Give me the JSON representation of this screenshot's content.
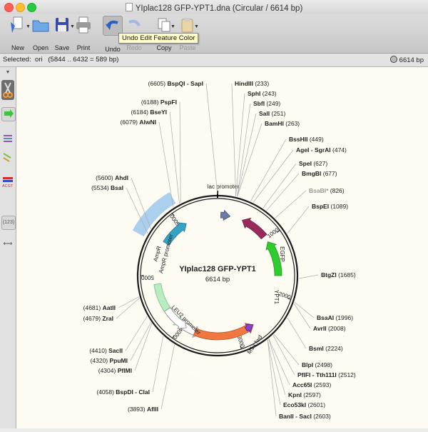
{
  "window": {
    "title": "YIplac128 GFP-YPT1.dna  (Circular / 6614 bp)"
  },
  "toolbar": {
    "new": "New",
    "open": "Open",
    "save": "Save",
    "print": "Print",
    "undo": "Undo",
    "redo": "Redo",
    "copy": "Copy",
    "paste": "Paste",
    "tooltip": "Undo Edit Feature Color"
  },
  "selection": {
    "label": "Selected:",
    "name": "ori",
    "range": "(5844 .. 6432  =  589 bp)",
    "total": "6614 bp"
  },
  "sidebar": {
    "count": "(123)"
  },
  "map": {
    "name": "YIplac128 GFP-YPT1",
    "length": "6614 bp",
    "colors": {
      "ori": "#4a7fc1",
      "lac": "#9aa0b5",
      "ypt1": "#9a2a5c",
      "egfp": "#2ecc2e",
      "ampr": "#b9ecc1",
      "leu2prom": "#ffffff",
      "leu2": "#f07840",
      "m13": "#8a40d0",
      "backbone": "#1a1a1a",
      "highlight": "#9cc8ec"
    },
    "features": [
      {
        "name": "ori",
        "label": "ori"
      },
      {
        "name": "lac-promoter",
        "label": "lac promoter"
      },
      {
        "name": "ypt1",
        "label": "YPT1"
      },
      {
        "name": "egfp",
        "label": "EGFP"
      },
      {
        "name": "ypt1-b",
        "label": "YPT1"
      },
      {
        "name": "ampr",
        "label": "AmpR"
      },
      {
        "name": "ampr-promoter",
        "label": "AmpR promoter"
      },
      {
        "name": "leu2-promoter",
        "label": "LEU2 promoter"
      },
      {
        "name": "leu2",
        "label": "LEU2"
      },
      {
        "name": "m13-fwd",
        "label": "M13 fwd"
      }
    ],
    "ticks": [
      "1000",
      "2000",
      "3000",
      "4000",
      "5000",
      "6000"
    ],
    "sites": [
      {
        "bold": "BspQI - SapI",
        "pos": "(6605)"
      },
      {
        "bold": "PspFI",
        "pos": "(6188)"
      },
      {
        "bold": "BseYI",
        "pos": "(6184)"
      },
      {
        "bold": "AlwNI",
        "pos": "(6079)"
      },
      {
        "bold": "AhdI",
        "pos": "(5600)"
      },
      {
        "bold": "BsaI",
        "pos": "(5534)"
      },
      {
        "bold": "AatII",
        "pos": "(4681)"
      },
      {
        "bold": "ZraI",
        "pos": "(4679)"
      },
      {
        "bold": "SacII",
        "pos": "(4410)"
      },
      {
        "bold": "PpuMI",
        "pos": "(4320)"
      },
      {
        "bold": "PflMI",
        "pos": "(4304)"
      },
      {
        "bold": "BspDI - ClaI",
        "pos": "(4058)"
      },
      {
        "bold": "AflII",
        "pos": "(3893)"
      },
      {
        "bold": "HindIII",
        "pos": "(233)"
      },
      {
        "bold": "SphI",
        "pos": "(243)"
      },
      {
        "bold": "SbfI",
        "pos": "(249)"
      },
      {
        "bold": "SalI",
        "pos": "(251)"
      },
      {
        "bold": "BamHI",
        "pos": "(263)"
      },
      {
        "bold": "BssHII",
        "pos": "(449)"
      },
      {
        "bold": "AgeI - SgrAI",
        "pos": "(474)"
      },
      {
        "bold": "SpeI",
        "pos": "(627)"
      },
      {
        "bold": "BmgBI",
        "pos": "(677)"
      },
      {
        "bold": "BsaBI*",
        "pos": "(826)"
      },
      {
        "bold": "BspEI",
        "pos": "(1089)"
      },
      {
        "bold": "BtgZI",
        "pos": "(1685)"
      },
      {
        "bold": "BsaAI",
        "pos": "(1996)"
      },
      {
        "bold": "AvrII",
        "pos": "(2008)"
      },
      {
        "bold": "BsmI",
        "pos": "(2224)"
      },
      {
        "bold": "BlpI",
        "pos": "(2498)"
      },
      {
        "bold": "PflFI - Tth111I",
        "pos": "(2512)"
      },
      {
        "bold": "Acc65I",
        "pos": "(2593)"
      },
      {
        "bold": "KpnI",
        "pos": "(2597)"
      },
      {
        "bold": "Eco53kI",
        "pos": "(2601)"
      },
      {
        "bold": "BanII - SacI",
        "pos": "(2603)"
      }
    ]
  }
}
